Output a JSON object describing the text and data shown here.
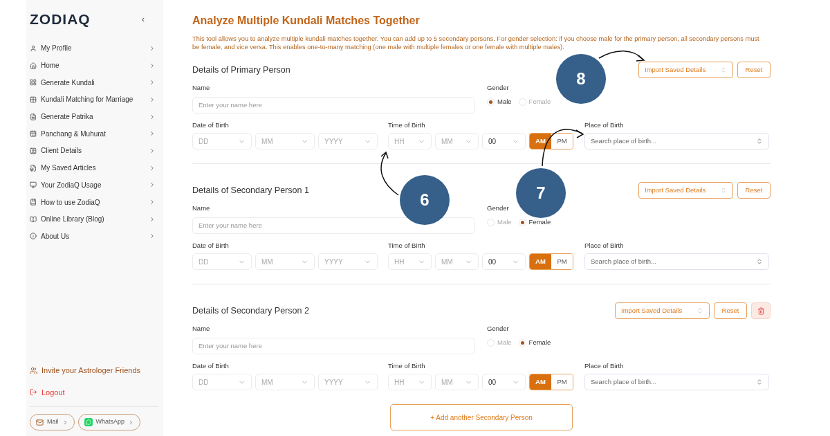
{
  "sidebar": {
    "logo": "ZODIAQ",
    "collapse": "‹",
    "items": [
      {
        "label": "My Profile"
      },
      {
        "label": "Home"
      },
      {
        "label": "Generate Kundali"
      },
      {
        "label": "Kundali Matching for Marriage"
      },
      {
        "label": "Generate Patrika"
      },
      {
        "label": "Panchang & Muhurat"
      },
      {
        "label": "Client Details"
      },
      {
        "label": "My Saved Articles"
      },
      {
        "label": "Your ZodiaQ Usage"
      },
      {
        "label": "How to use ZodiaQ"
      },
      {
        "label": "Online Library (Blog)"
      },
      {
        "label": "About Us"
      }
    ],
    "invite": "Invite your Astrologer Friends",
    "logout": "Logout",
    "contacts": [
      {
        "label": "Mail",
        "kind": "mail"
      },
      {
        "label": "WhatsApp",
        "kind": "whatsapp"
      }
    ]
  },
  "main": {
    "title": "Analyze Multiple Kundali Matches Together",
    "description": "This tool allows you to analyze multiple kundali matches together. You can add up to 5 secondary persons. For gender selection: if you choose male for the primary person, all secondary persons must be female, and vice versa. This enables one-to-many matching (one male with multiple females or one female with multiple males).",
    "persons": [
      {
        "title": "Details of Primary Person",
        "actions": [
          {
            "kind": "import",
            "label": "Import Saved Details"
          },
          {
            "kind": "reset",
            "label": "Reset"
          }
        ],
        "name_label": "Name",
        "name_placeholder": "Enter your name here",
        "gender_label": "Gender",
        "genders": [
          {
            "label": "Male",
            "selected": true
          },
          {
            "label": "Female",
            "selected": false
          }
        ],
        "dob_label": "Date of Birth",
        "dob": [
          "DD",
          "MM",
          "YYYY"
        ],
        "tob_label": "Time of Birth",
        "tob": [
          "HH",
          "MM"
        ],
        "seconds": "00",
        "meridiem": [
          {
            "label": "AM",
            "selected": true
          },
          {
            "label": "PM",
            "selected": false
          }
        ],
        "place_label": "Place of Birth",
        "place_placeholder": "Search place of birth..."
      },
      {
        "title": "Details of Secondary Person 1",
        "actions": [
          {
            "kind": "import",
            "label": "Import Saved Details"
          },
          {
            "kind": "reset",
            "label": "Reset"
          }
        ],
        "name_label": "Name",
        "name_placeholder": "Enter your name here",
        "gender_label": "Gender",
        "genders": [
          {
            "label": "Male",
            "selected": false
          },
          {
            "label": "Female",
            "selected": true
          }
        ],
        "dob_label": "Date of Birth",
        "dob": [
          "DD",
          "MM",
          "YYYY"
        ],
        "tob_label": "Time of Birth",
        "tob": [
          "HH",
          "MM"
        ],
        "seconds": "00",
        "meridiem": [
          {
            "label": "AM",
            "selected": true
          },
          {
            "label": "PM",
            "selected": false
          }
        ],
        "place_label": "Place of Birth",
        "place_placeholder": "Search place of birth..."
      },
      {
        "title": "Details of Secondary Person 2",
        "actions": [
          {
            "kind": "import",
            "label": "Import Saved Details"
          },
          {
            "kind": "reset",
            "label": "Reset"
          },
          {
            "kind": "delete"
          }
        ],
        "name_label": "Name",
        "name_placeholder": "Enter your name here",
        "gender_label": "Gender",
        "genders": [
          {
            "label": "Male",
            "selected": false
          },
          {
            "label": "Female",
            "selected": true
          }
        ],
        "dob_label": "Date of Birth",
        "dob": [
          "DD",
          "MM",
          "YYYY"
        ],
        "tob_label": "Time of Birth",
        "tob": [
          "HH",
          "MM"
        ],
        "seconds": "00",
        "meridiem": [
          {
            "label": "AM",
            "selected": true
          },
          {
            "label": "PM",
            "selected": false
          }
        ],
        "place_label": "Place of Birth",
        "place_placeholder": "Search place of birth..."
      }
    ],
    "add_button": "+ Add another Secondary Person"
  },
  "callouts": [
    {
      "number": "8"
    },
    {
      "number": "6"
    },
    {
      "number": "7"
    }
  ]
}
